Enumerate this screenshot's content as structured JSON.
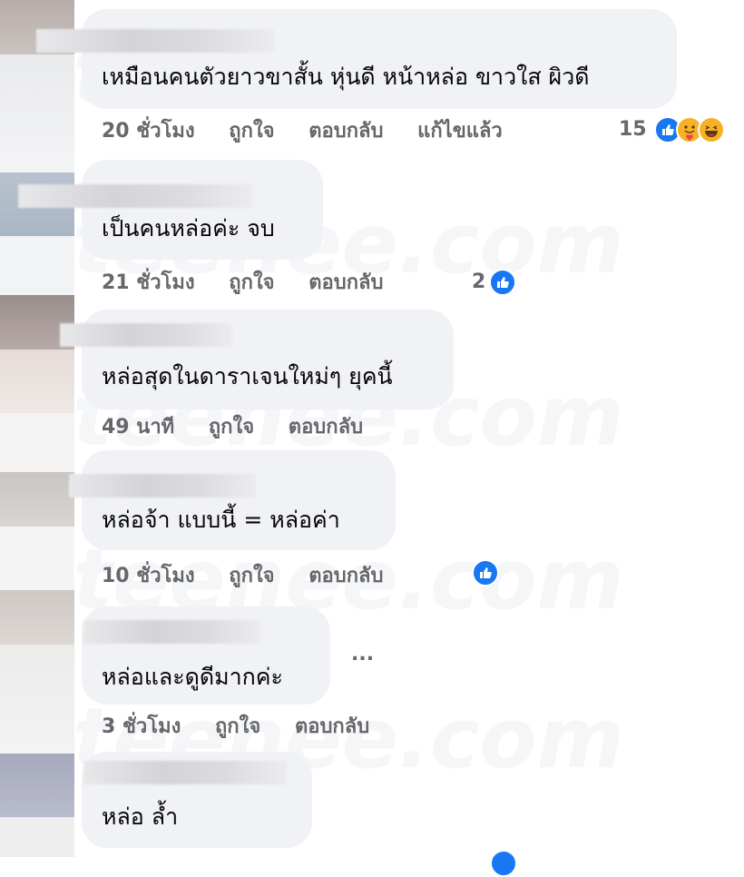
{
  "watermark": "teenee.com",
  "comments": [
    {
      "text": "เหมือนคนตัวยาวขาสั้น หุ่นดี หน้าหล่อ ขาวใส ผิวดี",
      "time": "20 ชั่วโมง",
      "like": "ถูกใจ",
      "reply": "ตอบกลับ",
      "edited": "แก้ไขแล้ว",
      "reaction_count": "15",
      "reactions": [
        "like-icon",
        "care-icon",
        "haha-icon"
      ]
    },
    {
      "text": "เป็นคนหล่อค่ะ จบ",
      "time": "21 ชั่วโมง",
      "like": "ถูกใจ",
      "reply": "ตอบกลับ",
      "reaction_count": "2",
      "reactions": [
        "like-icon"
      ]
    },
    {
      "text": "หล่อสุดในดาราเจนใหม่ๆ ยุคนี้",
      "time": "49 นาที",
      "like": "ถูกใจ",
      "reply": "ตอบกลับ"
    },
    {
      "text": "หล่อจ้า แบบนี้ = หล่อค่า",
      "time": "10 ชั่วโมง",
      "like": "ถูกใจ",
      "reply": "ตอบกลับ",
      "reactions": [
        "like-icon"
      ]
    },
    {
      "text": "หล่อและดูดีมากค่ะ",
      "time": "3 ชั่วโมง",
      "like": "ถูกใจ",
      "reply": "ตอบกลับ",
      "more": "..."
    },
    {
      "text": "หล่อ ล้ำ"
    }
  ],
  "colors": {
    "bubble": "#f0f2f5",
    "meta": "#65676b",
    "like_blue": "#1877f2",
    "emoji_yellow": "#f7b125"
  }
}
